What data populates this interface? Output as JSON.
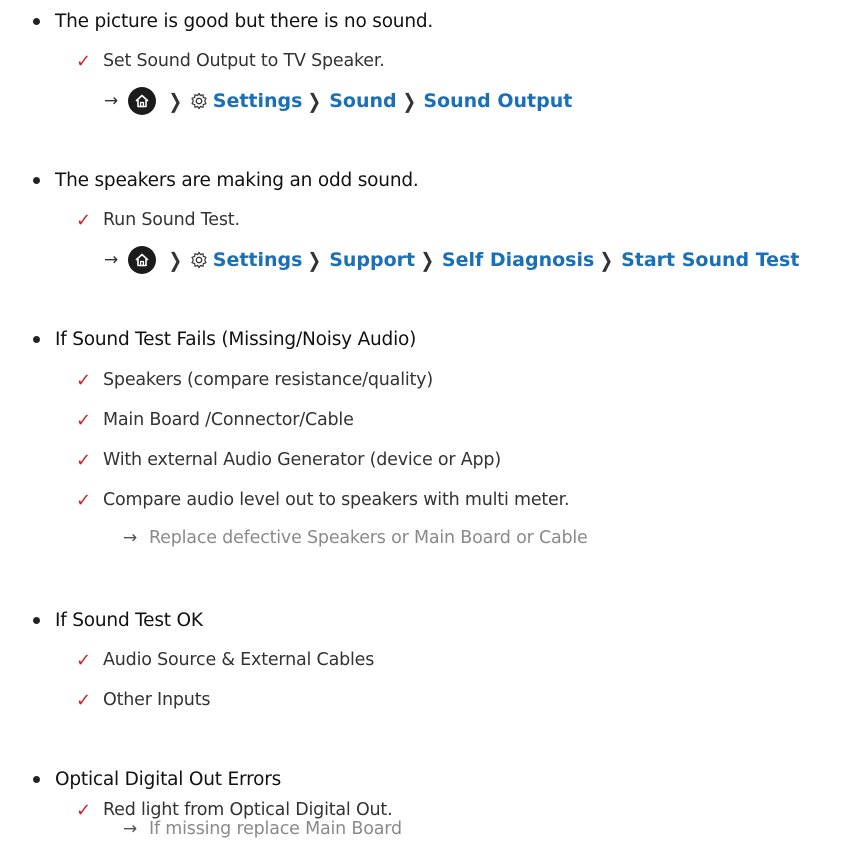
{
  "sections": [
    {
      "heading": "The picture is good but there is no sound.",
      "checks": [
        "Set Sound Output to TV Speaker."
      ],
      "path": [
        "Settings",
        "Sound",
        "Sound Output"
      ]
    },
    {
      "heading": "The speakers are making an odd sound.",
      "checks": [
        "Run Sound Test."
      ],
      "path": [
        "Settings",
        "Support",
        "Self Diagnosis",
        "Start Sound Test"
      ]
    },
    {
      "heading": "If Sound Test Fails (Missing/Noisy Audio)",
      "checks": [
        "Speakers (compare resistance/quality)",
        "Main Board /Connector/Cable",
        "With external Audio Generator (device or App)",
        "Compare audio level out to speakers with multi meter."
      ],
      "note": "Replace defective Speakers or Main Board or Cable"
    },
    {
      "heading": "If Sound Test OK",
      "checks": [
        "Audio Source & External Cables",
        "Other Inputs"
      ]
    },
    {
      "heading": "Optical Digital Out Errors",
      "checks": [
        "Red light from Optical Digital Out."
      ],
      "note": "If missing replace Main Board"
    }
  ],
  "icons": {
    "bullet": "bullet-dot",
    "check": "check-mark-icon",
    "arrow": "arrow-right-icon",
    "home": "home-icon",
    "chevron": "chevron-right-icon",
    "gear": "gear-icon"
  },
  "colors": {
    "check": "#d6202b",
    "path_link": "#1a6fb6",
    "note": "#8a8a8a",
    "text": "#222222"
  }
}
